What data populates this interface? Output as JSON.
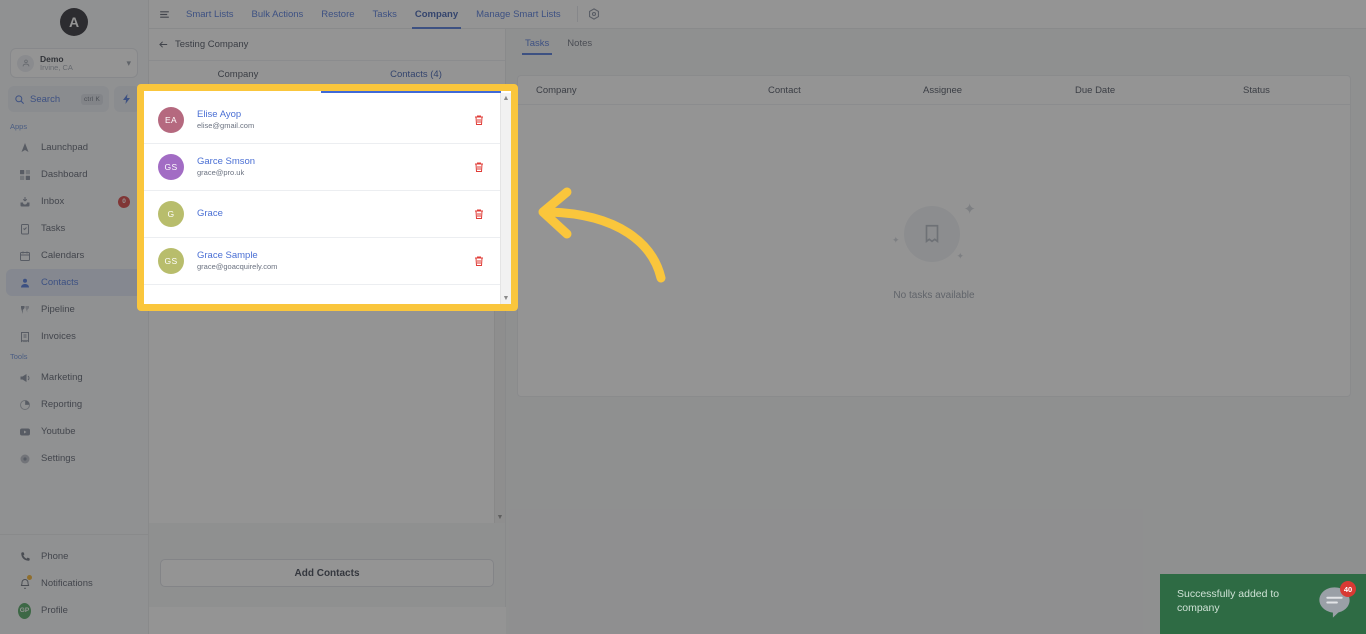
{
  "app": {
    "logo_initial": "A",
    "hamburger_icon": "hamburger-icon"
  },
  "sidebar": {
    "location": {
      "name": "Demo",
      "sub": "Irvine, CA",
      "chevron": "chevron-down-icon"
    },
    "search": {
      "label": "Search",
      "shortcut": "ctrl K",
      "icon": "search-icon"
    },
    "quick_action_icon": "lightning-bolt-icon",
    "groups": [
      {
        "label": "Apps",
        "items": [
          {
            "label": "Launchpad",
            "icon": "launchpad-icon",
            "active": false,
            "badge": ""
          },
          {
            "label": "Dashboard",
            "icon": "dashboard-icon",
            "active": false,
            "badge": ""
          },
          {
            "label": "Inbox",
            "icon": "inbox-icon",
            "active": false,
            "badge": "0"
          },
          {
            "label": "Tasks",
            "icon": "tasks-icon",
            "active": false,
            "badge": ""
          },
          {
            "label": "Calendars",
            "icon": "calendar-icon",
            "active": false,
            "badge": ""
          },
          {
            "label": "Contacts",
            "icon": "contacts-icon",
            "active": true,
            "badge": ""
          },
          {
            "label": "Pipeline",
            "icon": "pipeline-icon",
            "active": false,
            "badge": ""
          },
          {
            "label": "Invoices",
            "icon": "invoices-icon",
            "active": false,
            "badge": ""
          }
        ]
      },
      {
        "label": "Tools",
        "items": [
          {
            "label": "Marketing",
            "icon": "megaphone-icon",
            "active": false,
            "badge": ""
          },
          {
            "label": "Reporting",
            "icon": "piechart-icon",
            "active": false,
            "badge": ""
          },
          {
            "label": "Youtube",
            "icon": "youtube-icon",
            "active": false,
            "badge": ""
          },
          {
            "label": "Settings",
            "icon": "settings-icon",
            "active": false,
            "badge": ""
          }
        ]
      }
    ],
    "bottom_items": [
      {
        "label": "Phone",
        "icon": "phone-icon"
      },
      {
        "label": "Notifications",
        "icon": "bell-icon"
      },
      {
        "label": "Profile",
        "icon": "avatar-icon",
        "initials": "GP"
      }
    ]
  },
  "topbar": {
    "tabs": [
      {
        "label": "Smart Lists",
        "active": false
      },
      {
        "label": "Bulk Actions",
        "active": false
      },
      {
        "label": "Restore",
        "active": false
      },
      {
        "label": "Tasks",
        "active": false
      },
      {
        "label": "Company",
        "active": true
      },
      {
        "label": "Manage Smart Lists",
        "active": false
      }
    ],
    "settings_icon": "gear-icon"
  },
  "detail_panel": {
    "back_label": "Testing Company",
    "back_icon": "arrow-left-icon",
    "tabs": [
      {
        "label": "Company",
        "active": false
      },
      {
        "label": "Contacts (4)",
        "active": true
      }
    ],
    "contacts": [
      {
        "initials": "EA",
        "name": "Elise Ayop",
        "email": "elise@gmail.com",
        "color": "#b5697f"
      },
      {
        "initials": "GS",
        "name": "Garce Smson",
        "email": "grace@pro.uk",
        "color": "#a26cc4"
      },
      {
        "initials": "G",
        "name": "Grace",
        "email": "",
        "color": "#b8bd6c"
      },
      {
        "initials": "GS",
        "name": "Grace Sample",
        "email": "grace@goacquirely.com",
        "color": "#b8bd6c"
      }
    ],
    "delete_icon": "trash-icon",
    "scroll_up_icon": "triangle-up-icon",
    "scroll_down_icon": "triangle-down-icon",
    "add_contacts_label": "Add Contacts"
  },
  "main": {
    "tabs": [
      {
        "label": "Tasks",
        "active": true
      },
      {
        "label": "Notes",
        "active": false
      }
    ],
    "table_headers": [
      "Company",
      "Contact",
      "Assignee",
      "Due Date",
      "Status"
    ],
    "table_rows": [],
    "empty_state": {
      "text": "No tasks available",
      "icon": "empty-note-icon"
    }
  },
  "annotations": {
    "highlight_color": "#fac63c",
    "arrow_icon": "curved-arrow-left-icon"
  },
  "toast": {
    "message": "Successfully added to company",
    "background": "#2e6b44"
  },
  "chat_widget": {
    "icon": "chat-bubble-icon",
    "badge_count": "40",
    "badge_color": "#d83a34"
  }
}
